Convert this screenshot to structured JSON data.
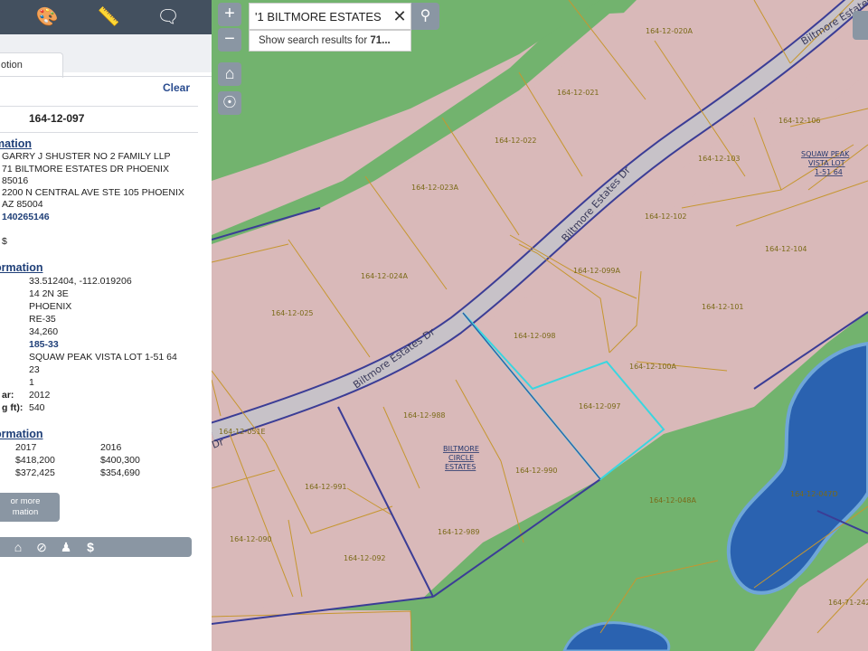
{
  "toolbar": {
    "icons": [
      "palette-icon",
      "ruler-icon",
      "comment-icon"
    ]
  },
  "panel": {
    "active_tab": "otion",
    "clear_label": "Clear",
    "apn": "164-12-097",
    "owner_section": "mation",
    "owner_name": "GARRY J SHUSTER NO 2 FAMILY LLP",
    "property_address_1": "71 BILTMORE ESTATES DR PHOENIX",
    "property_address_2": "85016",
    "mailing_address_1": "2200 N CENTRAL AVE STE 105 PHOENIX",
    "mailing_address_2": "AZ 85004",
    "deed_number": "140265146",
    "sale_price": "$",
    "property_section": "ormation",
    "lat_long": "33.512404, -112.019206",
    "township": "14 2N 3E",
    "jurisdiction": "PHOENIX",
    "zoning": "RE-35",
    "lot_size": "34,260",
    "mcr": "185-33",
    "subdivision": "SQUAW PEAK VISTA LOT 1-51 64",
    "lot": "23",
    "tract": "1",
    "year_label": "ar:",
    "year_value": "2012",
    "sqft_label": "g ft):",
    "sqft_value": "540",
    "valuation_section": "ormation",
    "val_year_a": "2017",
    "val_year_b": "2016",
    "val_fcv_a": "$418,200",
    "val_fcv_b": "$400,300",
    "val_lpv_a": "$372,425",
    "val_lpv_b": "$354,690",
    "more_button": "or more\nmation",
    "bottom_icons": [
      "home-icon",
      "no-signal-icon",
      "person-pin-icon",
      "dollar-icon"
    ]
  },
  "map_controls": {
    "zoom_in": "+",
    "zoom_out": "−",
    "search_value": "'1 BILTMORE ESTATES",
    "suggestion_prefix": "Show search results for ",
    "suggestion_bold": "71..."
  },
  "map": {
    "road_name": "Biltmore Estates Dr",
    "road_name_end": "Dr",
    "subdivisions": [
      {
        "lines": [
          "SQUAW PEAK",
          "VISTA LOT",
          "1-51 64"
        ]
      },
      {
        "lines": [
          "BILTMORE",
          "CIRCLE",
          "ESTATES"
        ]
      }
    ],
    "parcels": [
      "164-12-020A",
      "164-12-021",
      "164-12-022",
      "164-12-023A",
      "164-12-024A",
      "164-12-025",
      "164-12-106",
      "164-12-103",
      "164-12-102",
      "164-12-104",
      "164-12-099A",
      "164-12-101",
      "164-12-098",
      "164-12-100A",
      "164-12-097",
      "164-12-988",
      "164-12-990",
      "164-12-989",
      "164-12-991",
      "164-12-092",
      "164-12-090",
      "164-12-051E",
      "164-12-048A",
      "164-12-047D",
      "164-71-242"
    ],
    "colors": {
      "parcel_fill": "#d9b9b9",
      "green_space": "#72b36e",
      "water": "#2a62b0",
      "selected_outline": "#39d6e0",
      "parcel_line": "#c6962f",
      "subdivision_line": "#3b3d96"
    }
  }
}
